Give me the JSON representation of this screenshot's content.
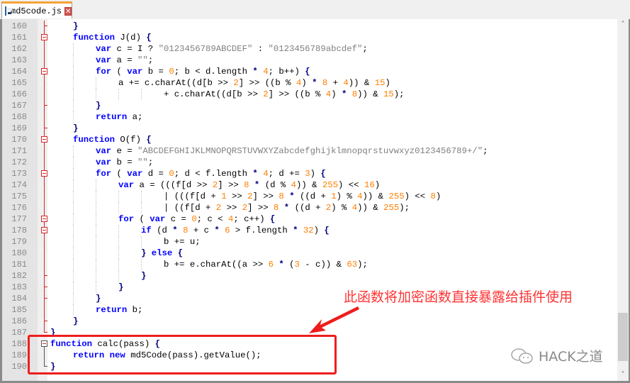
{
  "tab": {
    "filename": "md5code.js",
    "close": "✕"
  },
  "editor": {
    "lines": [
      {
        "n": "160",
        "fold": "tick",
        "indent": 1,
        "html": "<span class='op'>}</span>"
      },
      {
        "n": "161",
        "fold": "box",
        "indent": 1,
        "html": "<span class='kw'>function</span> J(d) <span class='op'>{</span>"
      },
      {
        "n": "162",
        "fold": "line",
        "indent": 2,
        "html": "<span class='kw'>var</span> c = I ? <span class='str'>\"0123456789ABCDEF\"</span> : <span class='str'>\"0123456789abcdef\"</span>;"
      },
      {
        "n": "163",
        "fold": "line",
        "indent": 2,
        "html": "<span class='kw'>var</span> a = <span class='str'>\"\"</span>;"
      },
      {
        "n": "164",
        "fold": "box",
        "indent": 2,
        "html": "<span class='kw'>for</span> ( <span class='kw'>var</span> b = <span class='num'>0</span>; b &lt; d.length <span class='op'>*</span> <span class='num'>4</span>; b++) <span class='op'>{</span>"
      },
      {
        "n": "165",
        "fold": "line",
        "indent": 3,
        "html": "a += c.charAt((d[b &gt;&gt; <span class='num'>2</span>] &gt;&gt; ((b % <span class='num'>4</span>) <span class='op'>*</span> <span class='num'>8</span> + <span class='num'>4</span>)) &amp; <span class='num'>15</span>)"
      },
      {
        "n": "166",
        "fold": "line",
        "indent": 5,
        "html": "+ c.charAt((d[b &gt;&gt; <span class='num'>2</span>] &gt;&gt; ((b % <span class='num'>4</span>) <span class='op'>*</span> <span class='num'>8</span>)) &amp; <span class='num'>15</span>);"
      },
      {
        "n": "167",
        "fold": "tick",
        "indent": 2,
        "html": "<span class='op'>}</span>"
      },
      {
        "n": "168",
        "fold": "line",
        "indent": 2,
        "html": "<span class='kw'>return</span> a;"
      },
      {
        "n": "169",
        "fold": "tick",
        "indent": 1,
        "html": "<span class='op'>}</span>"
      },
      {
        "n": "170",
        "fold": "box",
        "indent": 1,
        "html": "<span class='kw'>function</span> O(f) <span class='op'>{</span>"
      },
      {
        "n": "171",
        "fold": "line",
        "indent": 2,
        "html": "<span class='kw'>var</span> e = <span class='str'>\"ABCDEFGHIJKLMNOPQRSTUVWXYZabcdefghijklmnopqrstuvwxyz0123456789+/\"</span>;"
      },
      {
        "n": "172",
        "fold": "line",
        "indent": 2,
        "html": "<span class='kw'>var</span> b = <span class='str'>\"\"</span>;"
      },
      {
        "n": "173",
        "fold": "box",
        "indent": 2,
        "html": "<span class='kw'>for</span> ( <span class='kw'>var</span> d = <span class='num'>0</span>; d &lt; f.length <span class='op'>*</span> <span class='num'>4</span>; d += <span class='num'>3</span>) <span class='op'>{</span>"
      },
      {
        "n": "174",
        "fold": "line",
        "indent": 3,
        "html": "<span class='kw'>var</span> a = (((f[d &gt;&gt; <span class='num'>2</span>] &gt;&gt; <span class='num'>8</span> <span class='op'>*</span> (d % <span class='num'>4</span>)) &amp; <span class='num'>255</span>) &lt;&lt; <span class='num'>16</span>)"
      },
      {
        "n": "175",
        "fold": "line",
        "indent": 5,
        "html": "| (((f[d + <span class='num'>1</span> &gt;&gt; <span class='num'>2</span>] &gt;&gt; <span class='num'>8</span> <span class='op'>*</span> ((d + <span class='num'>1</span>) % <span class='num'>4</span>)) &amp; <span class='num'>255</span>) &lt;&lt; <span class='num'>8</span>)"
      },
      {
        "n": "176",
        "fold": "line",
        "indent": 5,
        "html": "| ((f[d + <span class='num'>2</span> &gt;&gt; <span class='num'>2</span>] &gt;&gt; <span class='num'>8</span> <span class='op'>*</span> ((d + <span class='num'>2</span>) % <span class='num'>4</span>)) &amp; <span class='num'>255</span>);"
      },
      {
        "n": "177",
        "fold": "box",
        "indent": 3,
        "html": "<span class='kw'>for</span> ( <span class='kw'>var</span> c = <span class='num'>0</span>; c &lt; <span class='num'>4</span>; c++) <span class='op'>{</span>"
      },
      {
        "n": "178",
        "fold": "box",
        "indent": 4,
        "html": "<span class='kw'>if</span> (d <span class='op'>*</span> <span class='num'>8</span> + c <span class='op'>*</span> <span class='num'>6</span> &gt; f.length <span class='op'>*</span> <span class='num'>32</span>) <span class='op'>{</span>"
      },
      {
        "n": "179",
        "fold": "line",
        "indent": 5,
        "html": "b += u;"
      },
      {
        "n": "180",
        "fold": "line",
        "indent": 4,
        "html": "<span class='op'>}</span> <span class='kw'>else</span> <span class='op'>{</span>"
      },
      {
        "n": "181",
        "fold": "line",
        "indent": 5,
        "html": "b += e.charAt((a &gt;&gt; <span class='num'>6</span> <span class='op'>*</span> (<span class='num'>3</span> - c)) &amp; <span class='num'>63</span>);"
      },
      {
        "n": "182",
        "fold": "tick",
        "indent": 4,
        "html": "<span class='op'>}</span>"
      },
      {
        "n": "183",
        "fold": "tick",
        "indent": 3,
        "html": "<span class='op'>}</span>"
      },
      {
        "n": "184",
        "fold": "tick",
        "indent": 2,
        "html": "<span class='op'>}</span>"
      },
      {
        "n": "185",
        "fold": "line",
        "indent": 2,
        "html": "<span class='kw'>return</span> b;"
      },
      {
        "n": "186",
        "fold": "tick",
        "indent": 1,
        "html": "<span class='op'>}</span>"
      },
      {
        "n": "187",
        "fold": "end",
        "indent": 0,
        "html": "<span class='op'>}</span>"
      },
      {
        "n": "188",
        "fold": "box",
        "indent": 0,
        "html": "<span class='kw'>function</span> calc(pass) <span class='op'>{</span>"
      },
      {
        "n": "189",
        "fold": "line",
        "indent": 1,
        "html": "<span class='kw'>return</span> <span class='kw'>new</span> md5Code(pass).getValue();"
      },
      {
        "n": "190",
        "fold": "end",
        "indent": 0,
        "html": "<span class='op'>}</span>"
      }
    ]
  },
  "annotation": {
    "text": "此函数将加密函数直接暴露给插件使用",
    "color": "#ff3333"
  },
  "watermark": {
    "text": "HACK之道"
  },
  "scrollbar": {
    "up": "˄",
    "down": "˅"
  }
}
